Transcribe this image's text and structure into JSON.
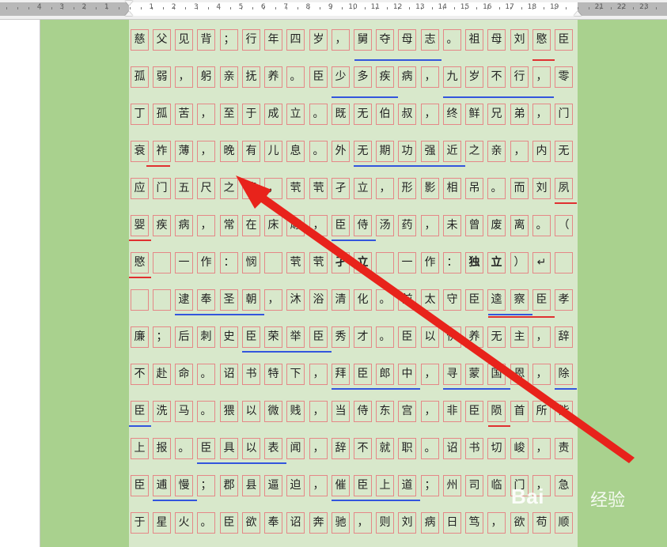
{
  "ruler": {
    "left_numbers": [
      "4",
      "3",
      "2",
      "1"
    ],
    "right_numbers": [
      "1",
      "2",
      "3",
      "4",
      "5",
      "6",
      "7",
      "8",
      "9",
      "10",
      "11",
      "12",
      "13",
      "14",
      "15",
      "16",
      "17",
      "18",
      "19",
      "21",
      "22",
      "23"
    ]
  },
  "document": {
    "rows": [
      "慈父见背；行年四岁，舅夺母志。祖母刘愍臣",
      "孤弱，躬亲抚养。臣少多疾病，九岁不行，零",
      "丁孤苦，至于成立。既无伯叔，终鲜兄弟，门",
      "衰祚薄，晚有儿息。外无期功强近之亲，内无",
      "应门五尺之僮，茕茕孑立，形影相吊。而刘夙",
      "婴疾病，常在床蓐，臣侍汤药，未曾废离。（",
      "愍 一作：悯 茕茕孑立 一作：独立）↵",
      "  逮奉圣朝，沐浴清化。前太守臣逵察臣孝",
      "廉；后刺史臣荣举臣秀才。臣以供养无主，辞",
      "不赴命。诏书特下，拜臣郎中，寻蒙国恩，除",
      "臣洗马。猥以微贱，当侍东宫，非臣陨首所能",
      "上报。臣具以表闻，辞不就职。诏书切峻，责",
      "臣逋慢；郡县逼迫，催臣上道；州司临门，急",
      "于星火。臣欲奉诏奔驰，则刘病日笃，欲苟顺"
    ]
  },
  "watermark": {
    "logo_text": "Bai",
    "suffix_text": "经验"
  },
  "colors": {
    "page_background": "#d8e8cb",
    "outer_background": "#a9d18e",
    "grid_lines": "#e58787",
    "arrow": "#e8231b"
  }
}
